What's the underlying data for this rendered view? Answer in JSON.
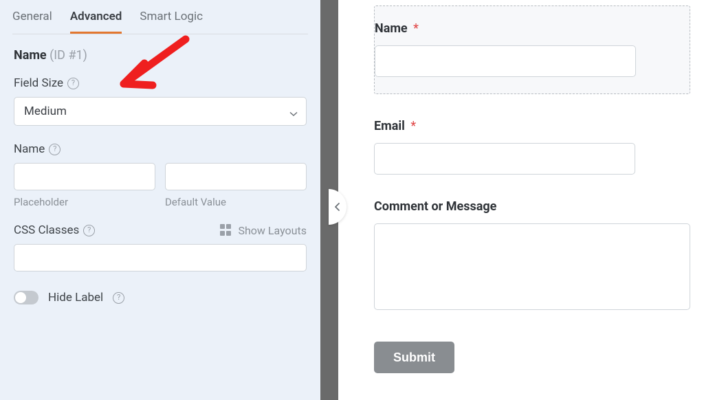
{
  "tabs": {
    "general": "General",
    "advanced": "Advanced",
    "smart_logic": "Smart Logic",
    "active": "advanced"
  },
  "field": {
    "name_strong": "Name",
    "id_text": "(ID #1)"
  },
  "field_size": {
    "label": "Field Size",
    "value": "Medium"
  },
  "name_section": {
    "label": "Name",
    "placeholder_sub": "Placeholder",
    "default_sub": "Default Value"
  },
  "css": {
    "label": "CSS Classes",
    "show_layouts": "Show Layouts"
  },
  "hide_label": {
    "label": "Hide Label",
    "on": false
  },
  "preview": {
    "name_label": "Name",
    "email_label": "Email",
    "comment_label": "Comment or Message",
    "submit": "Submit",
    "required_marker": "*"
  },
  "colors": {
    "accent": "#e27730",
    "required": "#e04545"
  }
}
